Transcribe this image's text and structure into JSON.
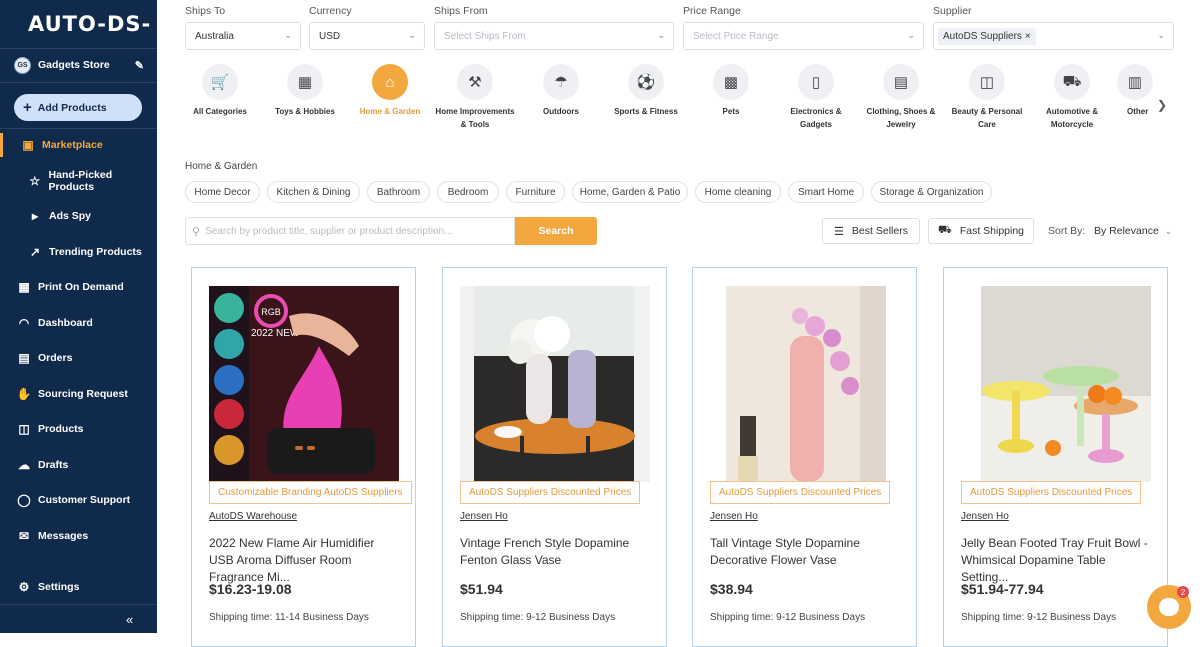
{
  "sidebar": {
    "logo": "AUTO-DS-",
    "store": {
      "initials": "GS",
      "name": "Gadgets Store"
    },
    "add_products": "Add Products",
    "items": [
      {
        "label": "Marketplace",
        "icon": "bag-icon"
      },
      {
        "label": "Hand-Picked Products",
        "icon": "star-box-icon"
      },
      {
        "label": "Ads Spy",
        "icon": "megaphone-icon"
      },
      {
        "label": "Trending Products",
        "icon": "trend-icon"
      },
      {
        "label": "Print On Demand",
        "icon": "print-store-icon"
      },
      {
        "label": "Dashboard",
        "icon": "gauge-icon"
      },
      {
        "label": "Orders",
        "icon": "orders-icon"
      },
      {
        "label": "Sourcing Request",
        "icon": "handshake-icon"
      },
      {
        "label": "Products",
        "icon": "box-icon"
      },
      {
        "label": "Drafts",
        "icon": "drafts-icon"
      },
      {
        "label": "Customer Support",
        "icon": "headset-icon"
      },
      {
        "label": "Messages",
        "icon": "mail-icon"
      },
      {
        "label": "Settings",
        "icon": "gear-icon"
      }
    ],
    "collapse": "«"
  },
  "filters": {
    "ships_to": {
      "label": "Ships To",
      "value": "Australia"
    },
    "currency": {
      "label": "Currency",
      "value": "USD"
    },
    "ships_from": {
      "label": "Ships From",
      "placeholder": "Select Ships From"
    },
    "price_range": {
      "label": "Price Range",
      "placeholder": "Select Price Range"
    },
    "supplier": {
      "label": "Supplier",
      "chip": "AutoDS Suppliers",
      "chip_remove": "×"
    }
  },
  "categories": [
    {
      "label": "All Categories",
      "icon": "cart-icon"
    },
    {
      "label": "Toys & Hobbies",
      "icon": "gamepad-icon"
    },
    {
      "label": "Home & Garden",
      "icon": "home-icon",
      "active": true
    },
    {
      "label": "Home Improvements & Tools",
      "icon": "tools-icon"
    },
    {
      "label": "Outdoors",
      "icon": "umbrella-icon"
    },
    {
      "label": "Sports & Fitness",
      "icon": "ball-icon"
    },
    {
      "label": "Pets",
      "icon": "pet-food-icon"
    },
    {
      "label": "Electronics & Gadgets",
      "icon": "phone-icon"
    },
    {
      "label": "Clothing, Shoes & Jewelry",
      "icon": "shirt-icon"
    },
    {
      "label": "Beauty & Personal Care",
      "icon": "cosmetics-icon"
    },
    {
      "label": "Automotive & Motorcycle",
      "icon": "car-icon"
    },
    {
      "label": "Other",
      "icon": "other-icon"
    }
  ],
  "breadcrumb": "Home & Garden",
  "subcategories": [
    "Home Decor",
    "Kitchen & Dining",
    "Bathroom",
    "Bedroom",
    "Furniture",
    "Home, Garden & Patio",
    "Home cleaning",
    "Smart Home",
    "Storage & Organization"
  ],
  "search": {
    "placeholder": "Search by product title, supplier or product description...",
    "button": "Search"
  },
  "toolbar": {
    "best_sellers": "Best Sellers",
    "fast_shipping": "Fast Shipping",
    "sort_label": "Sort By:",
    "sort_value": "By Relevance"
  },
  "products": [
    {
      "tag": "Customizable Branding   AutoDS Suppliers",
      "supplier": "AutoDS Warehouse",
      "title": "2022 New Flame Air Humidifier USB Aroma Diffuser Room Fragrance Mi...",
      "price": "$16.23-19.08",
      "shipping": "Shipping time: 11-14 Business Days",
      "image_text": {
        "badge": "RGB",
        "caption": "2022 NEW"
      }
    },
    {
      "tag": "AutoDS Suppliers Discounted Prices",
      "supplier": "Jensen Ho",
      "title": "Vintage French Style Dopamine Fenton Glass Vase",
      "price": "$51.94",
      "shipping": "Shipping time: 9-12 Business Days"
    },
    {
      "tag": "AutoDS Suppliers Discounted Prices",
      "supplier": "Jensen Ho",
      "title": "Tall Vintage Style Dopamine Decorative Flower Vase",
      "price": "$38.94",
      "shipping": "Shipping time: 9-12 Business Days"
    },
    {
      "tag": "AutoDS Suppliers Discounted Prices",
      "supplier": "Jensen Ho",
      "title": "Jelly Bean Footed Tray Fruit Bowl - Whimsical Dopamine Table Setting...",
      "price": "$51.94-77.94",
      "shipping": "Shipping time: 9-12 Business Days"
    }
  ],
  "chat": {
    "badge": "2"
  },
  "colors": {
    "sidebar": "#102a4c",
    "accent": "#f3a73f",
    "card_border": "#b9d2ec"
  }
}
